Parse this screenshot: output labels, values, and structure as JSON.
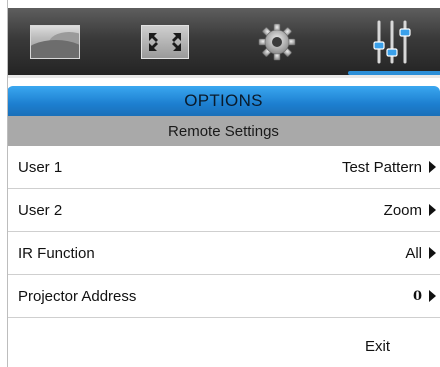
{
  "tabs": [
    {
      "icon": "image-icon"
    },
    {
      "icon": "display-fullscreen-icon"
    },
    {
      "icon": "gear-icon"
    },
    {
      "icon": "options-sliders-icon",
      "active": true
    }
  ],
  "menu": {
    "title": "OPTIONS",
    "subtitle": "Remote Settings",
    "rows": [
      {
        "label": "User 1",
        "value": "Test Pattern"
      },
      {
        "label": "User 2",
        "value": "Zoom"
      },
      {
        "label": "IR Function",
        "value": "All"
      },
      {
        "label": "Projector Address",
        "value": "0"
      }
    ],
    "exit_label": "Exit"
  },
  "colors": {
    "accent": "#2c8fd8",
    "title_bar": "#1d7fd0",
    "subtitle_bar": "#a9a9a9",
    "tab_bar": "#3a3a3a"
  }
}
